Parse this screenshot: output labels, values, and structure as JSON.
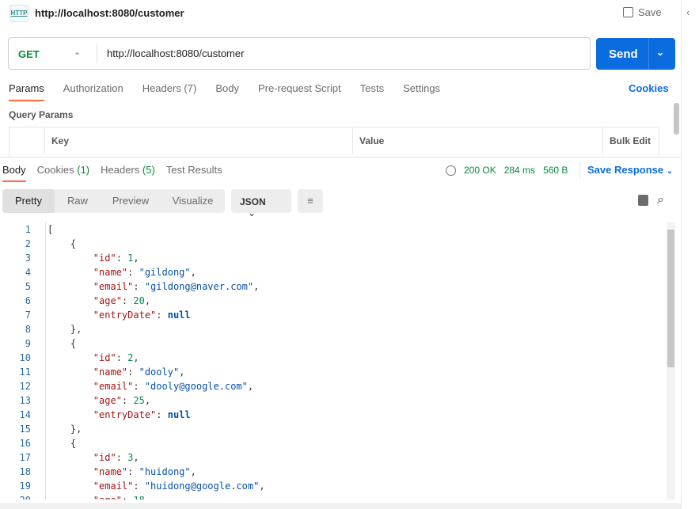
{
  "header": {
    "title": "http://localhost:8080/customer",
    "icon_label": "HTTP",
    "save_label": "Save"
  },
  "request": {
    "method": "GET",
    "url": "http://localhost:8080/customer",
    "send_label": "Send"
  },
  "request_tabs": [
    "Params",
    "Authorization",
    "Headers (7)",
    "Body",
    "Pre-request Script",
    "Tests",
    "Settings"
  ],
  "cookies_label": "Cookies",
  "query_params": {
    "title": "Query Params",
    "columns": [
      "Key",
      "Value",
      "Bulk Edit"
    ]
  },
  "response_tabs": {
    "body": "Body",
    "cookies": "Cookies",
    "cookies_count": "(1)",
    "headers": "Headers",
    "headers_count": "(5)",
    "tests": "Test Results"
  },
  "status": {
    "code": "200 OK",
    "time": "284 ms",
    "size": "560 B",
    "save_response": "Save Response"
  },
  "views": [
    "Pretty",
    "Raw",
    "Preview",
    "Visualize"
  ],
  "format": "JSON",
  "code_lines": [
    [
      [
        "p",
        "["
      ]
    ],
    [
      [
        "p",
        "    {"
      ]
    ],
    [
      [
        "p",
        "        "
      ],
      [
        "k",
        "\"id\""
      ],
      [
        "p",
        ": "
      ],
      [
        "n",
        "1"
      ],
      [
        "p",
        ","
      ]
    ],
    [
      [
        "p",
        "        "
      ],
      [
        "k",
        "\"name\""
      ],
      [
        "p",
        ": "
      ],
      [
        "s",
        "\"gildong\""
      ],
      [
        "p",
        ","
      ]
    ],
    [
      [
        "p",
        "        "
      ],
      [
        "k",
        "\"email\""
      ],
      [
        "p",
        ": "
      ],
      [
        "s",
        "\"gildong@naver.com\""
      ],
      [
        "p",
        ","
      ]
    ],
    [
      [
        "p",
        "        "
      ],
      [
        "k",
        "\"age\""
      ],
      [
        "p",
        ": "
      ],
      [
        "n",
        "20"
      ],
      [
        "p",
        ","
      ]
    ],
    [
      [
        "p",
        "        "
      ],
      [
        "k",
        "\"entryDate\""
      ],
      [
        "p",
        ": "
      ],
      [
        "nl",
        "null"
      ]
    ],
    [
      [
        "p",
        "    },"
      ]
    ],
    [
      [
        "p",
        "    {"
      ]
    ],
    [
      [
        "p",
        "        "
      ],
      [
        "k",
        "\"id\""
      ],
      [
        "p",
        ": "
      ],
      [
        "n",
        "2"
      ],
      [
        "p",
        ","
      ]
    ],
    [
      [
        "p",
        "        "
      ],
      [
        "k",
        "\"name\""
      ],
      [
        "p",
        ": "
      ],
      [
        "s",
        "\"dooly\""
      ],
      [
        "p",
        ","
      ]
    ],
    [
      [
        "p",
        "        "
      ],
      [
        "k",
        "\"email\""
      ],
      [
        "p",
        ": "
      ],
      [
        "s",
        "\"dooly@google.com\""
      ],
      [
        "p",
        ","
      ]
    ],
    [
      [
        "p",
        "        "
      ],
      [
        "k",
        "\"age\""
      ],
      [
        "p",
        ": "
      ],
      [
        "n",
        "25"
      ],
      [
        "p",
        ","
      ]
    ],
    [
      [
        "p",
        "        "
      ],
      [
        "k",
        "\"entryDate\""
      ],
      [
        "p",
        ": "
      ],
      [
        "nl",
        "null"
      ]
    ],
    [
      [
        "p",
        "    },"
      ]
    ],
    [
      [
        "p",
        "    {"
      ]
    ],
    [
      [
        "p",
        "        "
      ],
      [
        "k",
        "\"id\""
      ],
      [
        "p",
        ": "
      ],
      [
        "n",
        "3"
      ],
      [
        "p",
        ","
      ]
    ],
    [
      [
        "p",
        "        "
      ],
      [
        "k",
        "\"name\""
      ],
      [
        "p",
        ": "
      ],
      [
        "s",
        "\"huidong\""
      ],
      [
        "p",
        ","
      ]
    ],
    [
      [
        "p",
        "        "
      ],
      [
        "k",
        "\"email\""
      ],
      [
        "p",
        ": "
      ],
      [
        "s",
        "\"huidong@google.com\""
      ],
      [
        "p",
        ","
      ]
    ],
    [
      [
        "p",
        "        "
      ],
      [
        "k",
        "\"age\""
      ],
      [
        "p",
        ": "
      ],
      [
        "n",
        "18"
      ],
      [
        "p",
        ","
      ]
    ]
  ]
}
